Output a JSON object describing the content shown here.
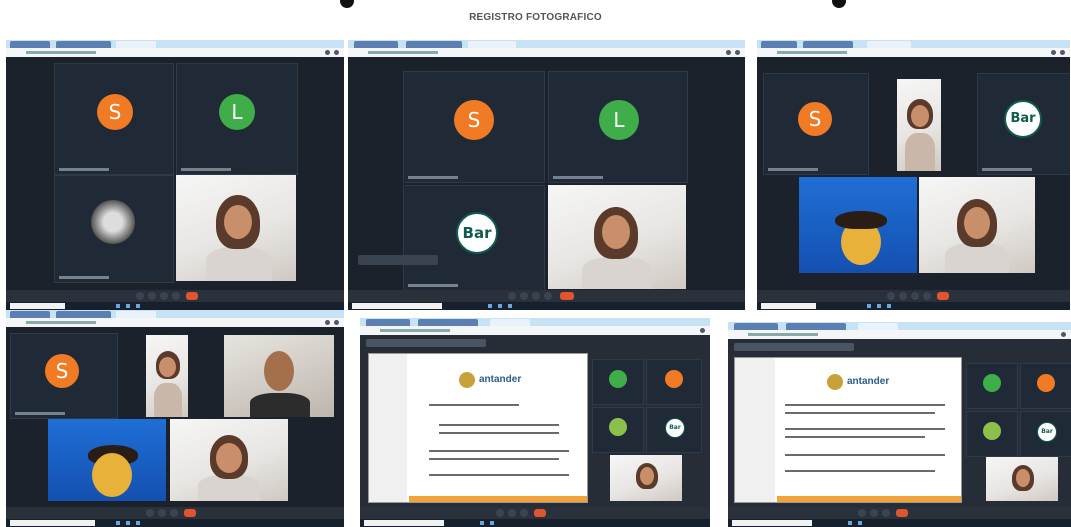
{
  "heading": "REGISTRO FOTOGRAFICO",
  "avatar_letters": {
    "s": "S",
    "l": "L"
  },
  "logo_text": "Bar",
  "slide_logo_text": "antander",
  "colors": {
    "orange": "#f07b24",
    "green": "#3fae49",
    "teams_bg": "#1f2733"
  }
}
